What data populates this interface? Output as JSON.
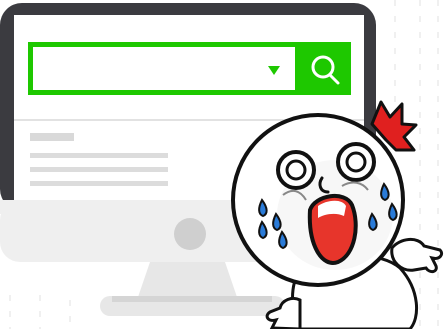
{
  "colors": {
    "monitor_frame": "#3b3b40",
    "screen": "#ffffff",
    "accent_green": "#1ec800",
    "stand": "#e7e7e7",
    "stand_shadow": "#d2d2d2",
    "placeholder_bar": "#dcdcdc",
    "sweat": "#2a7bd8",
    "mouth": "#e7352b",
    "flame": "#e0201f"
  },
  "search": {
    "dropdown_icon": "triangle-down",
    "submit_icon": "search-magnifier"
  },
  "character": {
    "name": "",
    "expression": "shocked-crying"
  }
}
